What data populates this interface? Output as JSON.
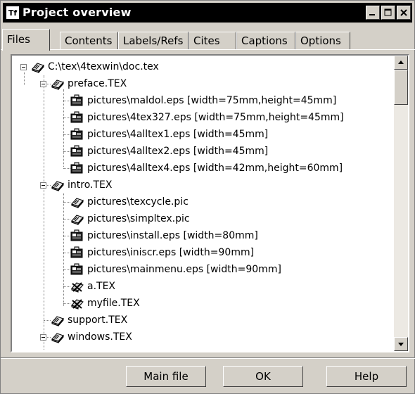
{
  "window": {
    "title": "Project overview",
    "app_icon_text": "Tf"
  },
  "tabs": [
    {
      "label": "Files",
      "active": true
    },
    {
      "label": "Contents",
      "active": false
    },
    {
      "label": "Labels/Refs",
      "active": false
    },
    {
      "label": "Cites",
      "active": false
    },
    {
      "label": "Captions",
      "active": false
    },
    {
      "label": "Options",
      "active": false
    }
  ],
  "tree": [
    {
      "label": "C:\\tex\\4texwin\\doc.tex",
      "icon": "tex-file-icon",
      "level": 0,
      "expanded": true
    },
    {
      "label": "preface.TEX",
      "icon": "tex-file-icon",
      "level": 1,
      "expanded": true
    },
    {
      "label": "pictures\\maldol.eps [width=75mm,height=45mm]",
      "icon": "image-file-icon",
      "level": 2
    },
    {
      "label": "pictures\\4tex327.eps [width=75mm,height=45mm]",
      "icon": "image-file-icon",
      "level": 2
    },
    {
      "label": "pictures\\4alltex1.eps [width=45mm]",
      "icon": "image-file-icon",
      "level": 2
    },
    {
      "label": "pictures\\4alltex2.eps [width=45mm]",
      "icon": "image-file-icon",
      "level": 2
    },
    {
      "label": "pictures\\4alltex4.eps [width=42mm,height=60mm]",
      "icon": "image-file-icon",
      "level": 2
    },
    {
      "label": "intro.TEX",
      "icon": "tex-file-icon",
      "level": 1,
      "expanded": true
    },
    {
      "label": "pictures\\texcycle.pic",
      "icon": "tex-file-icon",
      "level": 2
    },
    {
      "label": "pictures\\simpltex.pic",
      "icon": "tex-file-icon",
      "level": 2
    },
    {
      "label": "pictures\\install.eps [width=80mm]",
      "icon": "image-file-icon",
      "level": 2
    },
    {
      "label": "pictures\\iniscr.eps [width=90mm]",
      "icon": "image-file-icon",
      "level": 2
    },
    {
      "label": "pictures\\mainmenu.eps [width=90mm]",
      "icon": "image-file-icon",
      "level": 2
    },
    {
      "label": "a.TEX",
      "icon": "missing-tex-file-icon",
      "level": 2
    },
    {
      "label": "myfile.TEX",
      "icon": "missing-tex-file-icon",
      "level": 2
    },
    {
      "label": "support.TEX",
      "icon": "tex-file-icon",
      "level": 1
    },
    {
      "label": "windows.TEX",
      "icon": "tex-file-icon",
      "level": 1,
      "expanded": true
    }
  ],
  "buttons": {
    "main_file": "Main file",
    "ok": "OK",
    "help": "Help"
  }
}
